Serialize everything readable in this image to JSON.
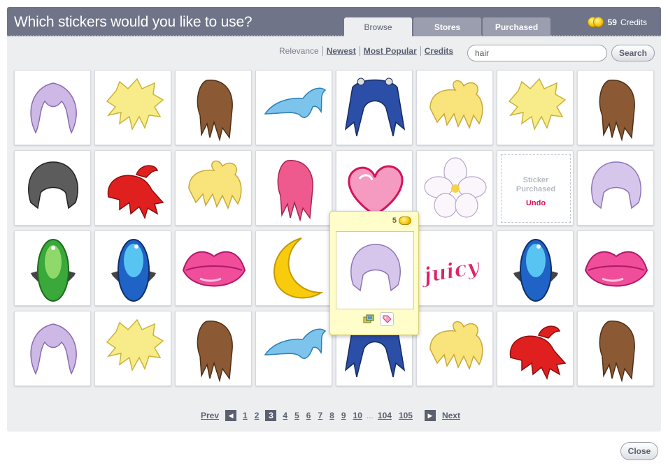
{
  "header": {
    "title": "Which stickers would you like to use?",
    "tabs": [
      {
        "label": "Browse",
        "active": true
      },
      {
        "label": "Stores",
        "active": false
      },
      {
        "label": "Purchased",
        "active": false
      }
    ],
    "credits_count": "59",
    "credits_label": "Credits"
  },
  "sort": {
    "relevance": "Relevance",
    "newest": "Newest",
    "most_popular": "Most Popular",
    "credits": "Credits"
  },
  "search": {
    "value": "hair",
    "button_label": "Search"
  },
  "grid": {
    "rows": [
      [
        "lavender-hair",
        "blonde-spiky-hair",
        "brown-long-hair",
        "blue-swoop-hair",
        "blue-pigtail-hair",
        "blonde-bun-hair",
        "blonde-spiky-hair",
        "brown-long-hair"
      ],
      [
        "black-hair",
        "red-ponytail-hair",
        "blonde-bun-hair",
        "pink-hair",
        "pink-heart",
        "white-flower",
        "purchased",
        "lavender-bob-hair"
      ],
      [
        "green-gem",
        "blue-gem",
        "pink-lips",
        "yellow-moon",
        "hidden",
        "juicy-text",
        "blue-gem",
        "pink-lips"
      ],
      [
        "lavender-hair",
        "blonde-spiky-hair",
        "brown-long-hair",
        "blue-swoop-hair",
        "blue-pigtail-hair",
        "blonde-bun-hair",
        "red-ponytail-hair",
        "brown-long-hair"
      ]
    ],
    "purchased_text_1": "Sticker",
    "purchased_text_2": "Purchased",
    "undo_label": "Undo",
    "juicy_text": "juicy"
  },
  "popup": {
    "price": "5",
    "sticker": "lavender-bob-hair"
  },
  "pagination": {
    "prev_label": "Prev",
    "next_label": "Next",
    "pages_before": [
      "1",
      "2"
    ],
    "current": "3",
    "pages_after": [
      "4",
      "5",
      "6",
      "7",
      "8",
      "9",
      "10"
    ],
    "ellipsis": "...",
    "pages_end": [
      "104",
      "105"
    ]
  },
  "footer": {
    "close_label": "Close"
  },
  "colors": {
    "header_bg": "#6f7488",
    "panel_bg": "#eceef0",
    "accent_pink": "#d4145a",
    "popup_bg": "#fffdc9"
  }
}
